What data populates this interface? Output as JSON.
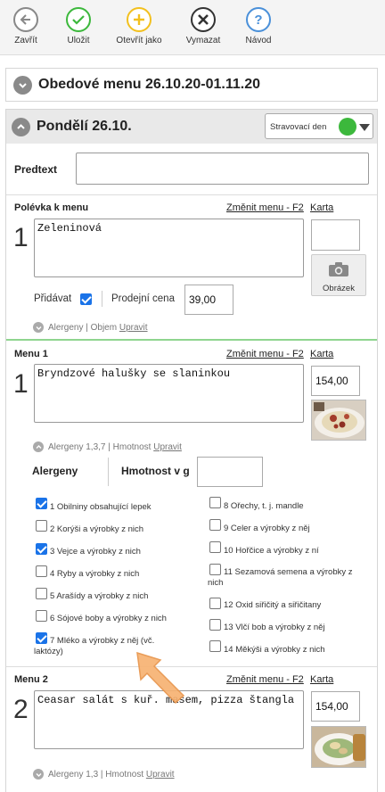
{
  "toolbar": {
    "close": "Zavřít",
    "save": "Uložit",
    "open_as": "Otevřít jako",
    "delete": "Vymazat",
    "help": "Návod"
  },
  "weekly_menu": {
    "title": "Obedové menu 26.10.20-01.11.20"
  },
  "day": {
    "title": "Pondělí 26.10.",
    "select_label": "Stravovací den",
    "status_color": "#3cb83c"
  },
  "predtext": {
    "label": "Predtext",
    "value": ""
  },
  "soup": {
    "label": "Polévka k menu",
    "change_link": "Změnit menu - F2",
    "card_link": "Karta",
    "number": "1",
    "text": "Zeleninová",
    "add_label": "Přidávat",
    "price_label": "Prodejní cena",
    "price": "39,00",
    "image_label": "Obrázek",
    "allergens_line": "Alergeny | Objem",
    "edit_link": "Upravit"
  },
  "menu1": {
    "label": "Menu 1",
    "change_link": "Změnit menu - F2",
    "card_link": "Karta",
    "number": "1",
    "text": "Bryndzové halušky se slaninkou",
    "price": "154,00",
    "allergens_line": "Alergeny 1,3,7 | Hmotnost",
    "edit_link": "Upravit",
    "allergens_header": "Alergeny",
    "weight_label": "Hmotnost v g",
    "weight_value": "",
    "allergens": [
      {
        "label": "1 Obilniny obsahující lepek",
        "checked": true
      },
      {
        "label": "2 Korýši a výrobky z nich",
        "checked": false
      },
      {
        "label": "3 Vejce a výrobky z nich",
        "checked": true
      },
      {
        "label": "4 Ryby a výrobky z nich",
        "checked": false
      },
      {
        "label": "5 Arašídy a výrobky z nich",
        "checked": false
      },
      {
        "label": "6 Sójové boby a výrobky z nich",
        "checked": false
      },
      {
        "label": "7 Mléko a výrobky z něj (vč. laktózy)",
        "checked": true
      },
      {
        "label": "8 Ořechy, t. j. mandle",
        "checked": false
      },
      {
        "label": "9 Celer a výrobky z něj",
        "checked": false
      },
      {
        "label": "10 Hořčice a výrobky z ní",
        "checked": false
      },
      {
        "label": "11 Sezamová semena a výrobky z nich",
        "checked": false
      },
      {
        "label": "12 Oxid siřičitý a siřičitany",
        "checked": false
      },
      {
        "label": "13 Vlčí bob a výrobky z něj",
        "checked": false
      },
      {
        "label": "14 Měkýši a výrobky z nich",
        "checked": false
      }
    ]
  },
  "menu2": {
    "label": "Menu 2",
    "change_link": "Změnit menu - F2",
    "card_link": "Karta",
    "number": "2",
    "text": "Ceasar salát s kuř. masem, pizza štangla",
    "price": "154,00",
    "allergens_line": "Alergeny 1,3 | Hmotnost",
    "edit_link": "Upravit"
  },
  "colors": {
    "accent_green": "#3cb83c",
    "accent_yellow": "#f2c01e",
    "help_blue": "#4a90d9",
    "arrow_orange": "#f5a55a"
  }
}
